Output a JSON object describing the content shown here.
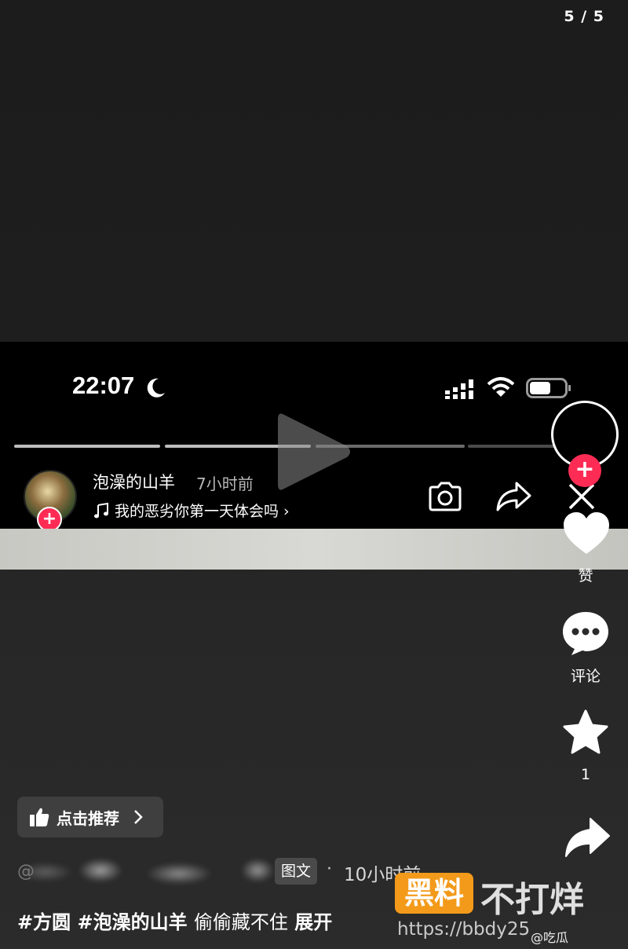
{
  "page_indicator": "5 / 5",
  "inner_screenshot": {
    "status_time": "22:07",
    "author_name": "泡澡的山羊",
    "post_time": "7小时前",
    "music_title": "我的恶劣你第一天体会吗 ›",
    "progress_segments": 5,
    "progress_active": 2
  },
  "actions": {
    "follow_plus": "+",
    "like_label": "赞",
    "comment_label": "评论",
    "favorite_count": "1"
  },
  "bottom": {
    "recommend_label": "点击推荐",
    "at_sign": "@",
    "badge": "图文",
    "separator": "·",
    "time": "10小时前",
    "caption_tags": "#方圆 #泡澡的山羊",
    "caption_text": "偷偷藏不住",
    "expand": "展开"
  },
  "watermark": {
    "box": "黑料",
    "text": "不打烊",
    "url": "https://bbdy25",
    "weibo": "@吃瓜"
  },
  "colors": {
    "accent_red": "#fe2c55",
    "watermark_orange": "#f39a1a"
  }
}
